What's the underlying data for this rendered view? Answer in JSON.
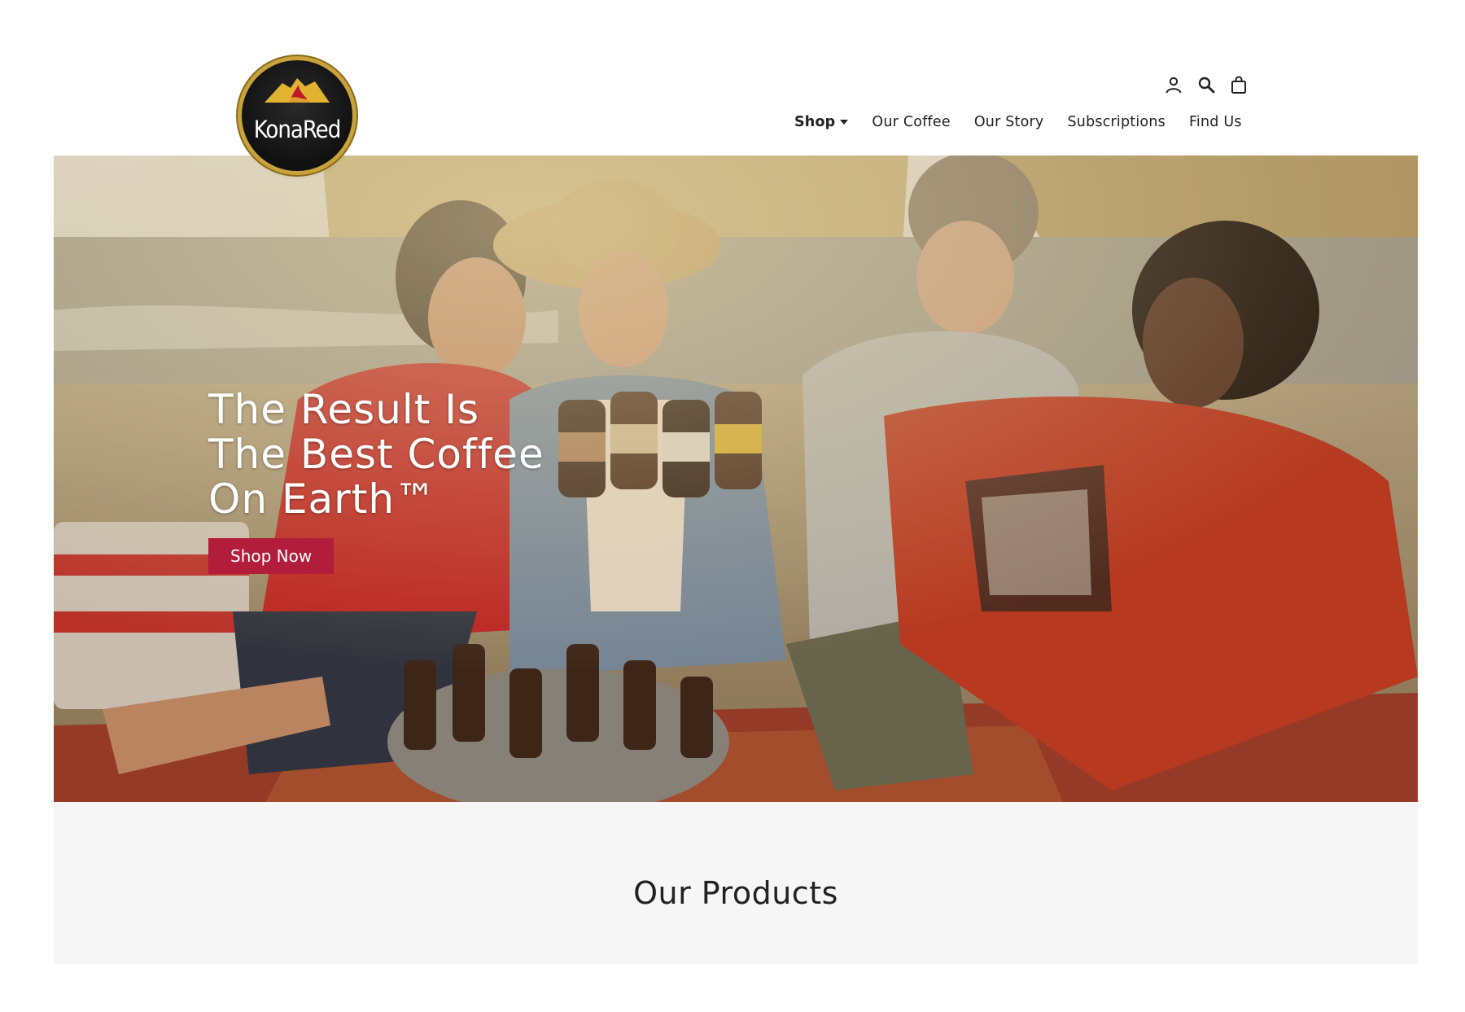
{
  "brand": {
    "name": "KonaRed",
    "logo_text": "KonaRed"
  },
  "header": {
    "icons": [
      "account-icon",
      "search-icon",
      "cart-icon"
    ],
    "nav": [
      {
        "label": "Shop",
        "active": true,
        "has_dropdown": true
      },
      {
        "label": "Our Coffee"
      },
      {
        "label": "Our Story"
      },
      {
        "label": "Subscriptions"
      },
      {
        "label": "Find Us"
      }
    ]
  },
  "hero": {
    "title_lines": [
      "The Result Is",
      "The Best Coffee",
      "On Earth™"
    ],
    "cta_label": "Shop Now",
    "cta_color": "#b21d3b"
  },
  "products": {
    "heading": "Our Products"
  },
  "colors": {
    "accent": "#b21d3b",
    "logo_ring": "#c9a23a",
    "products_bg": "#f6f6f6"
  }
}
